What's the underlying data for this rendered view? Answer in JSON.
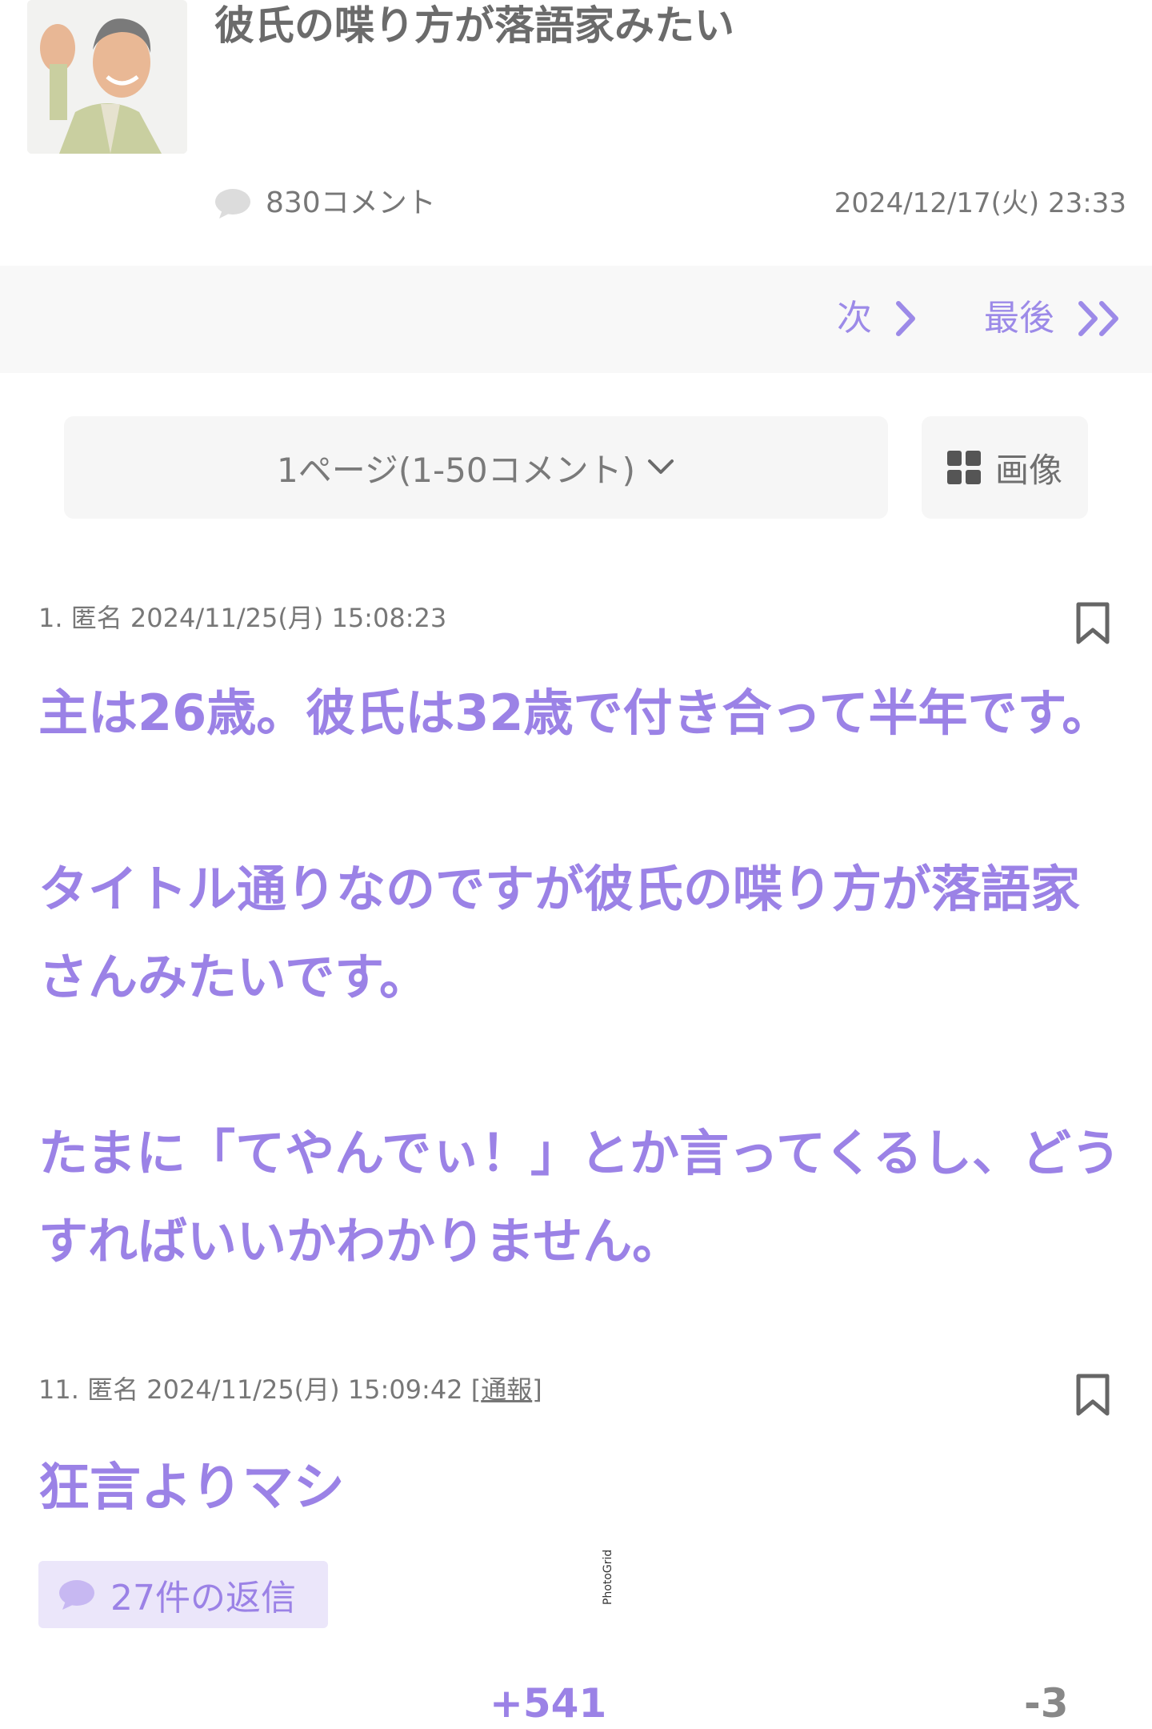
{
  "header": {
    "title": "彼氏の喋り方が落語家みたい",
    "comment_count": "830コメント",
    "date": "2024/12/17(火) 23:33",
    "thumbnail_icon": "man-portrait-image"
  },
  "pager": {
    "next_label": "次",
    "last_label": "最後"
  },
  "page_select": {
    "selected": "1ページ(1-50コメント)"
  },
  "images_button": {
    "label": "画像"
  },
  "comments": [
    {
      "header": "1. 匿名 2024/11/25(月) 15:08:23",
      "paragraphs": [
        "主は26歳。彼氏は32歳で付き合って半年です。",
        "タイトル通りなのですが彼氏の喋り方が落語家さんみたいです。",
        "たまに「てやんでぃ！」とか言ってくるし、どうすればいいかわかりません。"
      ]
    },
    {
      "header": "11. 匿名 2024/11/25(月) 15:09:42",
      "report_open": "[",
      "report_label": "通報",
      "report_close": "]",
      "body": "狂言よりマシ",
      "replies": "27件の返信",
      "votes_plus": "+541",
      "votes_minus": "-3"
    }
  ],
  "watermark": "PhotoGrid",
  "colors": {
    "accent": "#9b82e6",
    "pager_bg": "#f8f8f8",
    "reply_bg": "#ebe6fa"
  }
}
